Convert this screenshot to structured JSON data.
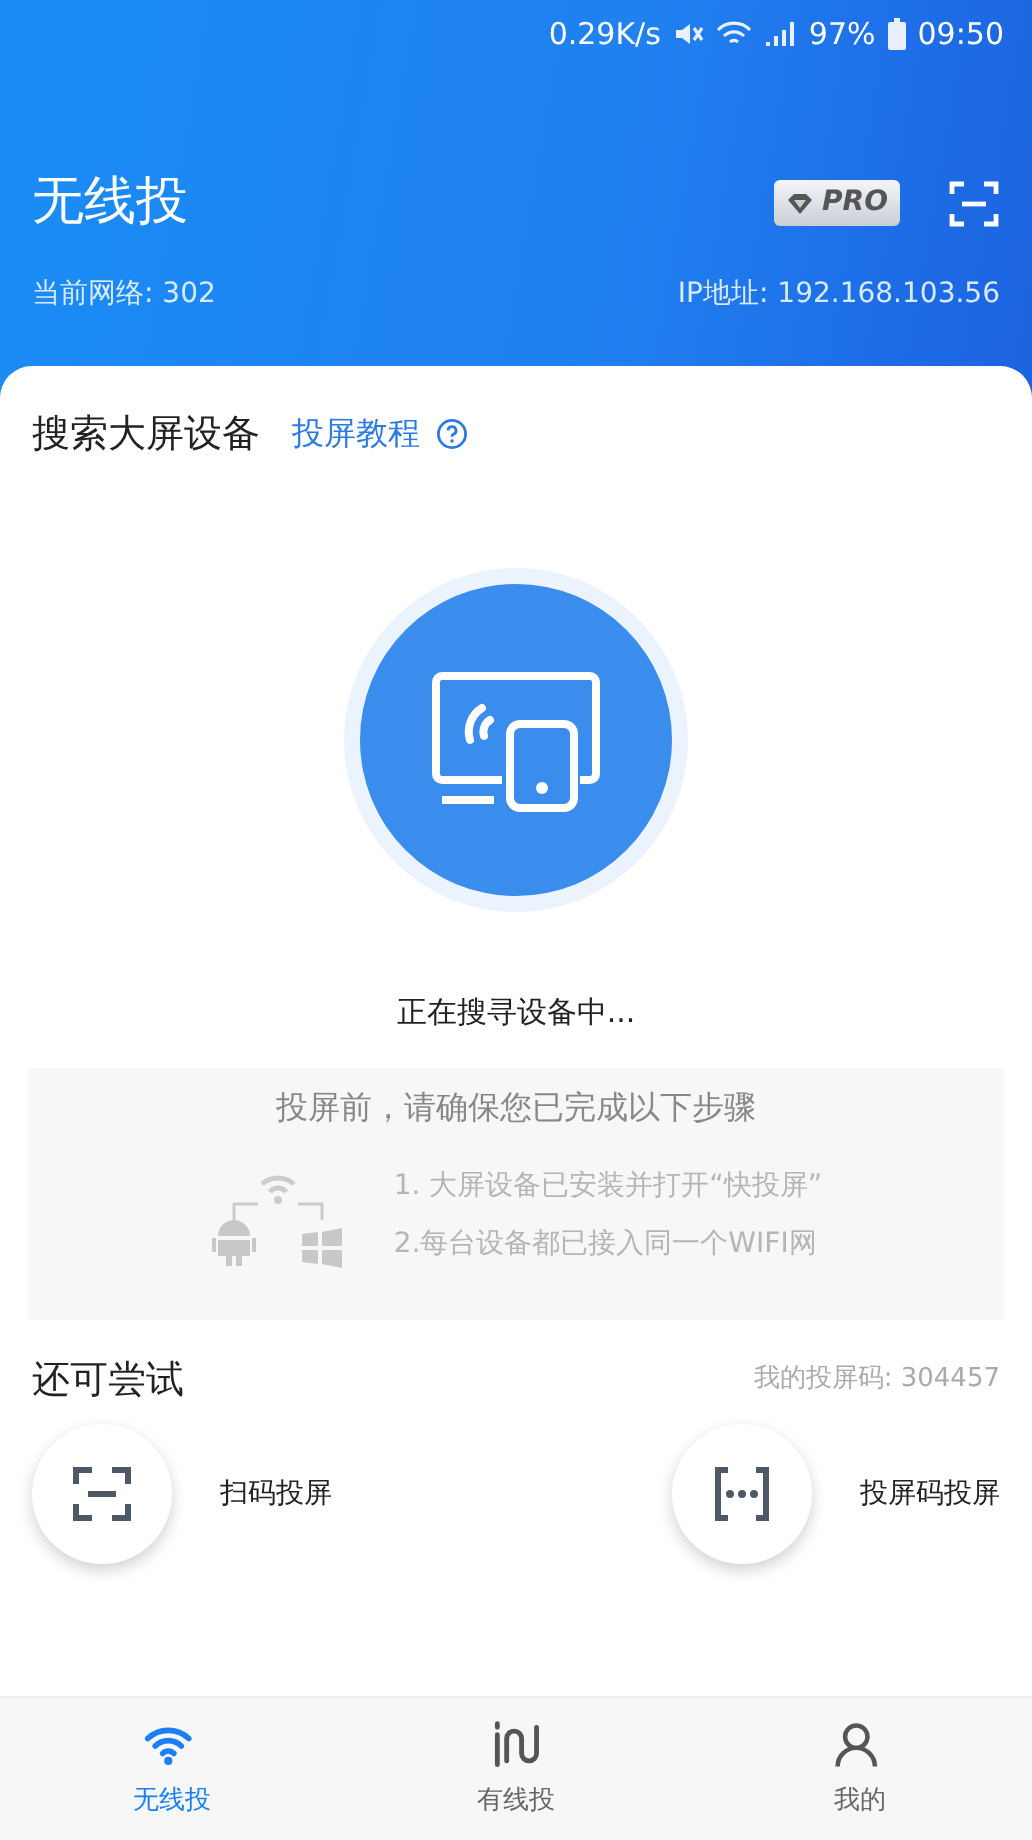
{
  "status_bar": {
    "speed": "0.29K/s",
    "battery": "97%",
    "time": "09:50"
  },
  "header": {
    "title": "无线投",
    "pro_badge": "PRO",
    "network": "当前网络: 302",
    "ip": "IP地址: 192.168.103.56"
  },
  "search": {
    "title": "搜索大屏设备",
    "tutorial_link": "投屏教程",
    "status": "正在搜寻设备中..."
  },
  "tips": {
    "title": "投屏前，请确保您已完成以下步骤",
    "steps": [
      "1. 大屏设备已安装并打开“快投屏”",
      "2.每台设备都已接入同一个WIFI网"
    ]
  },
  "try": {
    "title": "还可尝试",
    "cast_code": "我的投屏码: 304457",
    "options": [
      {
        "kind": "scan",
        "label": "扫码投屏"
      },
      {
        "kind": "code",
        "label": "投屏码投屏"
      }
    ]
  },
  "tab_bar": [
    {
      "kind": "wifi",
      "label": "无线投",
      "selected": true
    },
    {
      "kind": "cable",
      "label": "有线投",
      "selected": false
    },
    {
      "kind": "person",
      "label": "我的",
      "selected": false
    }
  ]
}
